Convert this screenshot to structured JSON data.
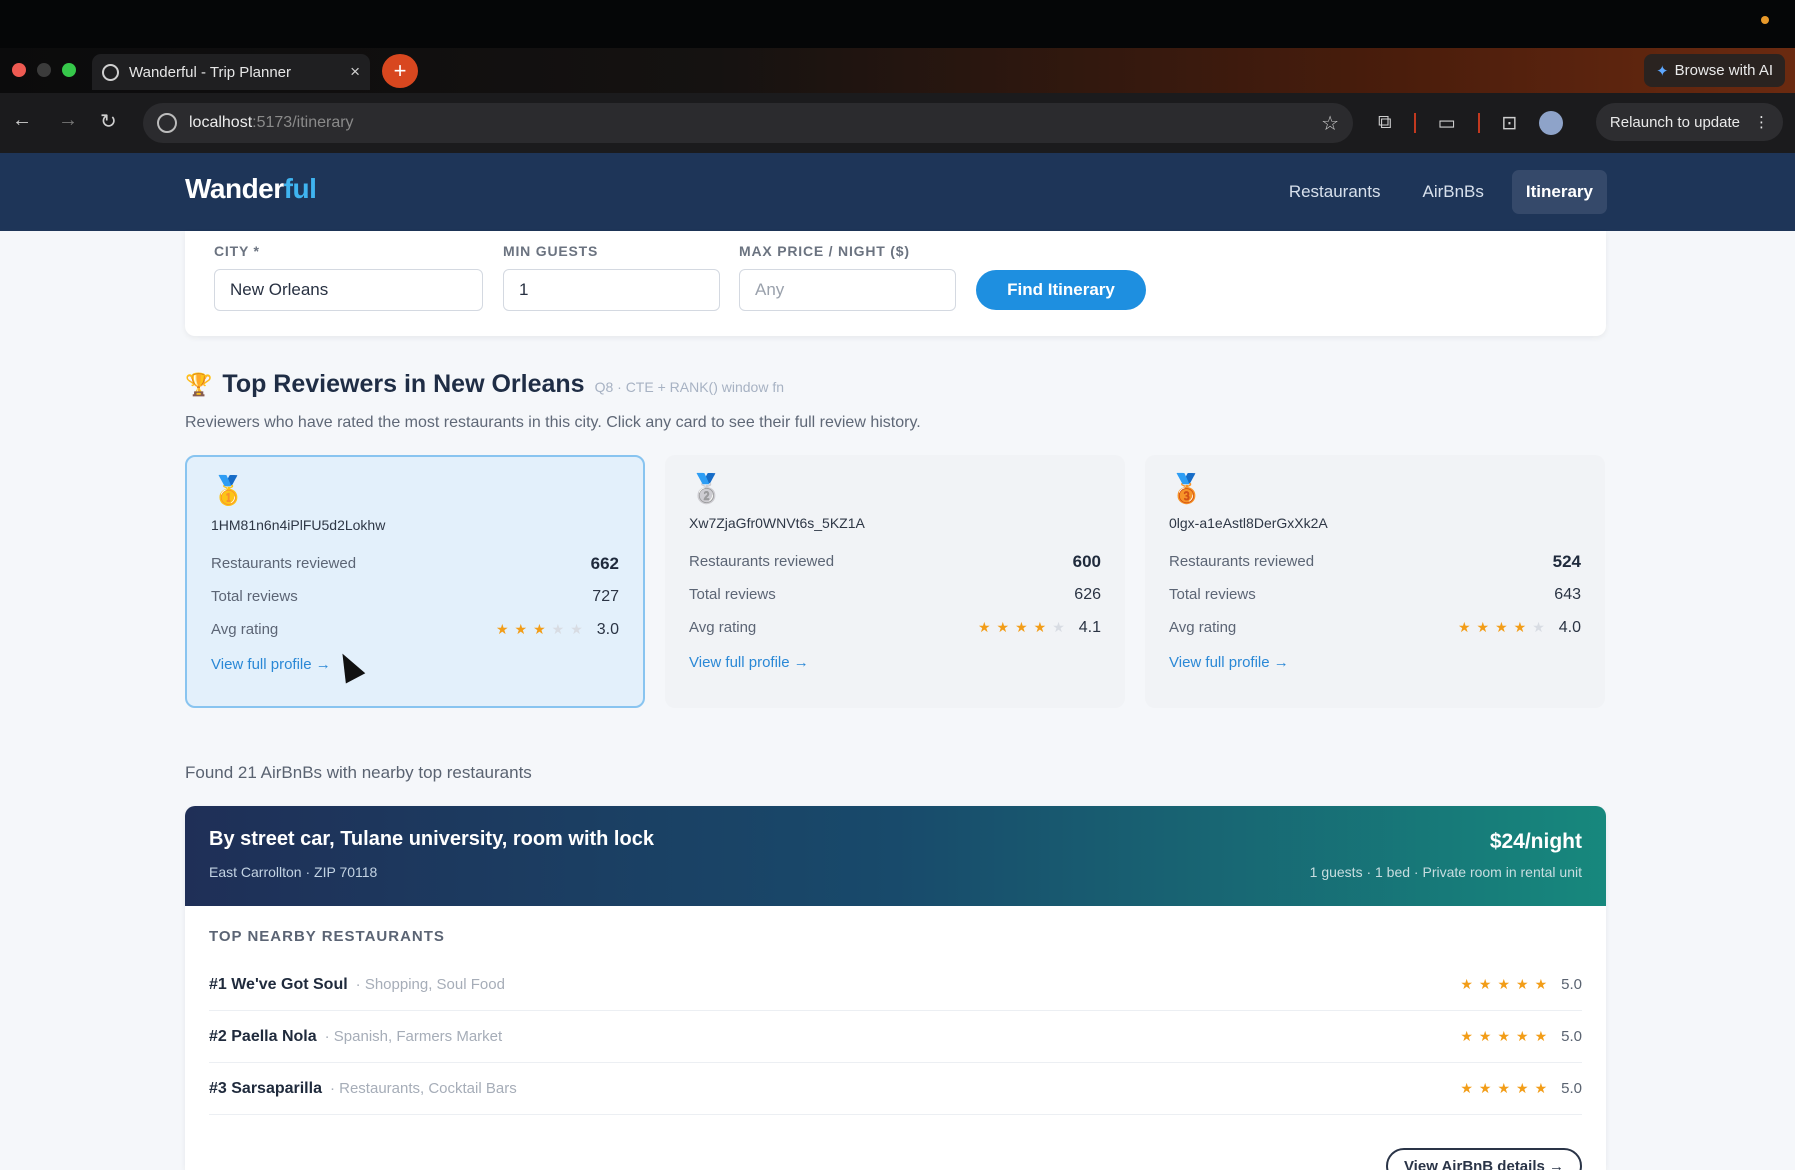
{
  "browser": {
    "tab_title": "Wanderful - Trip Planner",
    "tab_close": "×",
    "new_tab": "+",
    "browse_ai": "Browse with AI",
    "url_host": "localhost",
    "url_path": ":5173/itinerary",
    "relaunch": "Relaunch to update",
    "traffic_colors": [
      "#ee5a52",
      "#3b3b3b",
      "#36c84a"
    ]
  },
  "app": {
    "logo_main": "Wander",
    "logo_accent": "ful",
    "nav": [
      "Restaurants",
      "AirBnBs",
      "Itinerary"
    ],
    "active_nav": "Itinerary"
  },
  "search": {
    "city_label": "CITY *",
    "city_value": "New Orleans",
    "guests_label": "MIN GUESTS",
    "guests_value": "1",
    "price_label": "MAX PRICE / NIGHT ($)",
    "price_placeholder": "Any",
    "button": "Find Itinerary"
  },
  "reviewers": {
    "title": "Top Reviewers in New Orleans",
    "tag": "Q8 · CTE + RANK() window fn",
    "subtitle": "Reviewers who have rated the most restaurants in this city. Click any card to see their full review history.",
    "labels": {
      "restaurants": "Restaurants reviewed",
      "total": "Total reviews",
      "avg": "Avg rating",
      "link": "View full profile →"
    },
    "cards": [
      {
        "medal": "gold",
        "id": "1HM81n6n4iPlFU5d2Lokhw",
        "restaurants": "662",
        "total": "727",
        "rating": "3.0",
        "stars": 3
      },
      {
        "medal": "silver",
        "id": "Xw7ZjaGfr0WNVt6s_5KZ1A",
        "restaurants": "600",
        "total": "626",
        "rating": "4.1",
        "stars": 4
      },
      {
        "medal": "bronze",
        "id": "0lgx-a1eAstl8DerGxXk2A",
        "restaurants": "524",
        "total": "643",
        "rating": "4.0",
        "stars": 4
      }
    ]
  },
  "results": {
    "found": "Found 21 AirBnBs with nearby top restaurants"
  },
  "airbnb": {
    "name": "By street car, Tulane university, room with lock",
    "location": "East Carrollton · ZIP 70118",
    "price": "$24/night",
    "meta": "1 guests · 1 bed · Private room in rental unit",
    "section": "TOP NEARBY RESTAURANTS",
    "restaurants": [
      {
        "rank": "#1 We've Got Soul",
        "cats": "· Shopping, Soul Food",
        "rating": "5.0",
        "stars": 5
      },
      {
        "rank": "#2 Paella Nola",
        "cats": "· Spanish, Farmers Market",
        "rating": "5.0",
        "stars": 5
      },
      {
        "rank": "#3 Sarsaparilla",
        "cats": "· Restaurants, Cocktail Bars",
        "rating": "5.0",
        "stars": 5
      }
    ],
    "view_button": "View AirBnB details →"
  }
}
